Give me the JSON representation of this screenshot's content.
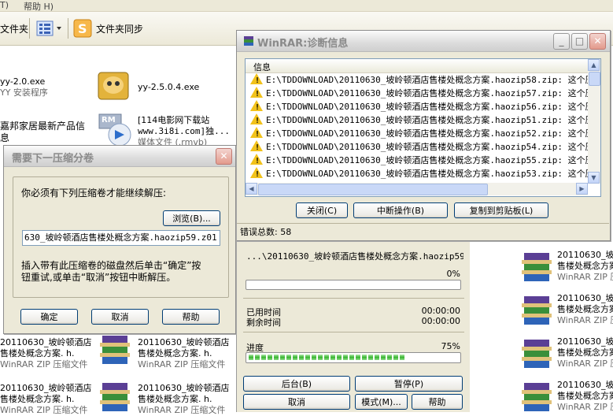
{
  "menubar": {
    "help": "帮助 H)",
    "tools": "T)"
  },
  "toolbar": {
    "folders_label": "文件夹",
    "sync_label": "文件夹同步"
  },
  "explorer_files": {
    "yy2": {
      "name": "yy-2.0.exe",
      "desc": "YY 安装程序"
    },
    "yy25": {
      "name": "yy-2.5.0.4.exe"
    },
    "home": {
      "line1": "嘉邦家居最新产品信",
      "line2": "息"
    },
    "rm": {
      "line1": "[114电影网下载站",
      "line2": "www.3i8i.com]独...",
      "line3": "媒体文件 (.rmvb)",
      "badge": "RM"
    },
    "rar_tiles": [
      {
        "line1": "20110630_坡岭顿酒店",
        "line2": "售楼处概念方案. h.",
        "line3": "WinRAR ZIP 压缩文件"
      },
      {
        "line1": "20110630_坡岭顿酒店",
        "line2": "售楼处概念方案. h.",
        "line3": "WinRAR ZIP 压缩文件"
      }
    ],
    "right_tiles": [
      {
        "line1": "20110630_坡岭",
        "line2": "售楼处概念方案",
        "line3": "WinRAR ZIP 压缩"
      }
    ]
  },
  "diag": {
    "title": "WinRAR:诊断信息",
    "column_header": "信息",
    "rows": [
      {
        "text": "E:\\TDDOWNLOAD\\20110630_坡岭顿酒店售楼处概念方案.haozip58.zip: 这个压缩"
      },
      {
        "text": "E:\\TDDOWNLOAD\\20110630_坡岭顿酒店售楼处概念方案.haozip57.zip: 这个压缩"
      },
      {
        "text": "E:\\TDDOWNLOAD\\20110630_坡岭顿酒店售楼处概念方案.haozip56.zip: 这个压缩"
      },
      {
        "text": "E:\\TDDOWNLOAD\\20110630_坡岭顿酒店售楼处概念方案.haozip51.zip: 这个压缩"
      },
      {
        "text": "E:\\TDDOWNLOAD\\20110630_坡岭顿酒店售楼处概念方案.haozip52.zip: 这个压缩"
      },
      {
        "text": "E:\\TDDOWNLOAD\\20110630_坡岭顿酒店售楼处概念方案.haozip54.zip: 这个压缩"
      },
      {
        "text": "E:\\TDDOWNLOAD\\20110630_坡岭顿酒店售楼处概念方案.haozip55.zip: 这个压缩"
      },
      {
        "text": "E:\\TDDOWNLOAD\\20110630_坡岭顿酒店售楼处概念方案.haozip53.zip: 这个压缩"
      }
    ],
    "close_label": "关闭(C)",
    "abort_label": "中断操作(B)",
    "copy_label": "复制到剪贴板(L)",
    "error_total": "错误总数: 58"
  },
  "progress": {
    "path": "...\\20110630_坡岭顿酒店售楼处概念方案.haozip59",
    "file_percent": "0%",
    "file_fraction": 0.0,
    "elapsed_label": "已用时间",
    "elapsed_value": "00:00:00",
    "remaining_label": "剩余时间",
    "remaining_value": "00:00:00",
    "progress_label": "进度",
    "total_percent": "75%",
    "total_fraction": 0.75,
    "background_label": "后台(B)",
    "pause_label": "暂停(P)",
    "cancel_label": "取消",
    "mode_label": "模式(M)...",
    "help_label": "帮助"
  },
  "nextvol": {
    "title": "需要下一压缩分卷",
    "message": "你必须有下列压缩卷才能继续解压:",
    "browse_label": "浏览(B)...",
    "path_value": "630_坡岭顿酒店售楼处概念方案.haozip59.z01",
    "instruction_line1": "插入带有此压缩卷的磁盘然后单击“确定”按",
    "instruction_line2": "钮重试,或单击“取消”按钮中断解压。",
    "ok_label": "确定",
    "cancel_label": "取消",
    "help_label": "帮助"
  },
  "colors": {
    "warning": "#f2c21a",
    "progress_green": "#37b52f",
    "xp_border": "#003c74"
  }
}
